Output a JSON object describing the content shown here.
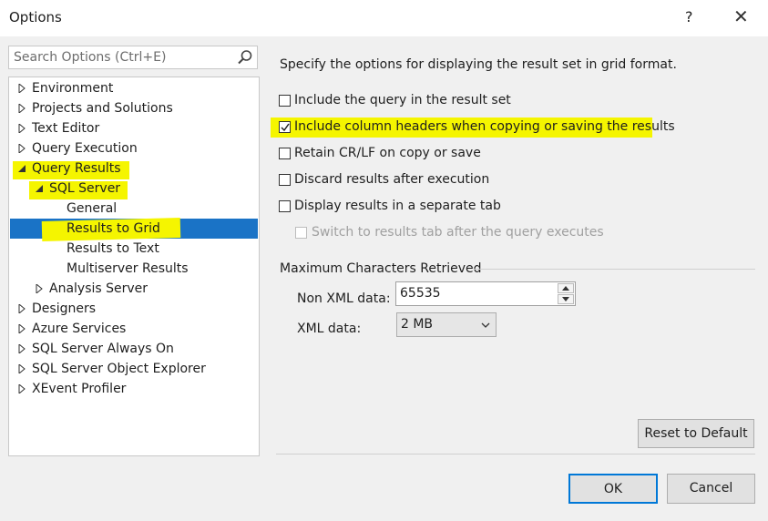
{
  "window": {
    "title": "Options",
    "help": "?",
    "close": "✕"
  },
  "search": {
    "placeholder": "Search Options (Ctrl+E)"
  },
  "tree": {
    "items": [
      {
        "label": "Environment"
      },
      {
        "label": "Projects and Solutions"
      },
      {
        "label": "Text Editor"
      },
      {
        "label": "Query Execution"
      },
      {
        "label": "Query Results"
      },
      {
        "label": "SQL Server"
      },
      {
        "label": "General"
      },
      {
        "label": "Results to Grid"
      },
      {
        "label": "Results to Text"
      },
      {
        "label": "Multiserver Results"
      },
      {
        "label": "Analysis Server"
      },
      {
        "label": "Designers"
      },
      {
        "label": "Azure Services"
      },
      {
        "label": "SQL Server Always On"
      },
      {
        "label": "SQL Server Object Explorer"
      },
      {
        "label": "XEvent Profiler"
      }
    ]
  },
  "panel": {
    "description": "Specify the options for displaying the result set in grid format.",
    "options": [
      {
        "label": "Include the query in the result set",
        "checked": false
      },
      {
        "label": "Include column headers when copying or saving the results",
        "checked": true
      },
      {
        "label": "Retain CR/LF on copy or save",
        "checked": false
      },
      {
        "label": "Discard results after execution",
        "checked": false
      },
      {
        "label": "Display results in a separate tab",
        "checked": false
      },
      {
        "label": "Switch to results tab after the query executes",
        "checked": false
      }
    ],
    "group_title": "Maximum Characters Retrieved",
    "non_xml_label": "Non XML data:",
    "non_xml_value": "65535",
    "xml_label": "XML data:",
    "xml_value": "2 MB"
  },
  "buttons": {
    "reset": "Reset to Default",
    "ok": "OK",
    "cancel": "Cancel"
  },
  "colors": {
    "selection": "#1a73c6",
    "highlight": "#f5f500",
    "accent": "#0078d7"
  }
}
